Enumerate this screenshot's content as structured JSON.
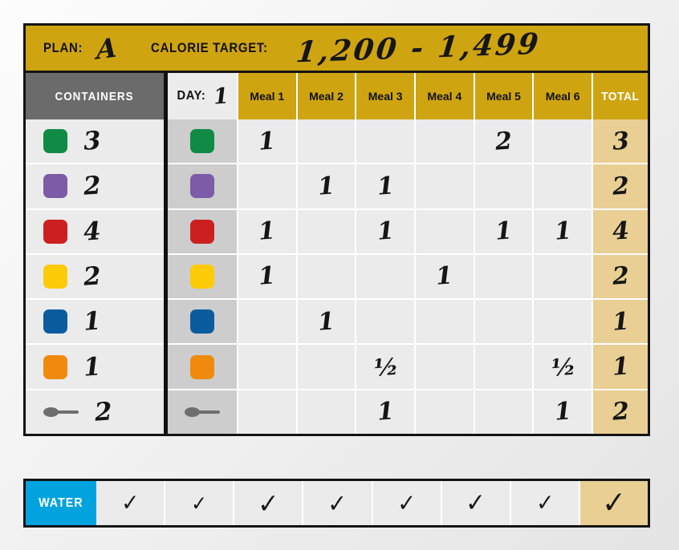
{
  "banner": {
    "plan_label": "PLAN:",
    "plan_value": "A",
    "calorie_label": "CALORIE TARGET:",
    "calorie_value": "1,200 - 1,499",
    "bg_color": "#cfa411"
  },
  "containers_panel": {
    "header": "CONTAINERS",
    "header_bg": "#6b6b6b",
    "rows": [
      {
        "color_name": "green",
        "color": "#0f8b45",
        "icon": "container-swatch",
        "qty": "3"
      },
      {
        "color_name": "purple",
        "color": "#7d5ba6",
        "icon": "container-swatch",
        "qty": "2"
      },
      {
        "color_name": "red",
        "color": "#cc2020",
        "icon": "container-swatch",
        "qty": "4"
      },
      {
        "color_name": "yellow",
        "color": "#fdcb07",
        "icon": "container-swatch",
        "qty": "2"
      },
      {
        "color_name": "blue",
        "color": "#0b5c9e",
        "icon": "container-swatch",
        "qty": "1"
      },
      {
        "color_name": "orange",
        "color": "#f08a0c",
        "icon": "container-swatch",
        "qty": "1"
      },
      {
        "color_name": "spoon",
        "color": "#6e6e6e",
        "icon": "teaspoon-icon",
        "qty": "2"
      }
    ]
  },
  "grid": {
    "day_label": "DAY:",
    "day_value": "1",
    "meal_headers": [
      "Meal 1",
      "Meal 2",
      "Meal 3",
      "Meal 4",
      "Meal 5",
      "Meal 6"
    ],
    "total_header": "TOTAL",
    "total_cell_bg": "#e9cf93",
    "rows": [
      {
        "color_name": "green",
        "color": "#0f8b45",
        "icon": "container-swatch",
        "meals": [
          "1",
          "",
          "",
          "",
          "2",
          ""
        ],
        "total": "3"
      },
      {
        "color_name": "purple",
        "color": "#7d5ba6",
        "icon": "container-swatch",
        "meals": [
          "",
          "1",
          "1",
          "",
          "",
          ""
        ],
        "total": "2"
      },
      {
        "color_name": "red",
        "color": "#cc2020",
        "icon": "container-swatch",
        "meals": [
          "1",
          "",
          "1",
          "",
          "1",
          "1"
        ],
        "total": "4"
      },
      {
        "color_name": "yellow",
        "color": "#fdcb07",
        "icon": "container-swatch",
        "meals": [
          "1",
          "",
          "",
          "1",
          "",
          ""
        ],
        "total": "2"
      },
      {
        "color_name": "blue",
        "color": "#0b5c9e",
        "icon": "container-swatch",
        "meals": [
          "",
          "1",
          "",
          "",
          "",
          ""
        ],
        "total": "1"
      },
      {
        "color_name": "orange",
        "color": "#f08a0c",
        "icon": "container-swatch",
        "meals": [
          "",
          "",
          "½",
          "",
          "",
          "½"
        ],
        "total": "1"
      },
      {
        "color_name": "spoon",
        "color": "#6e6e6e",
        "icon": "teaspoon-icon",
        "meals": [
          "",
          "",
          "1",
          "",
          "",
          "1"
        ],
        "total": "2"
      }
    ]
  },
  "water": {
    "label": "WATER",
    "label_bg": "#00a3dd",
    "checks": [
      "✓",
      "✓",
      "✓",
      "✓",
      "✓",
      "✓",
      "✓",
      "✓"
    ],
    "last_cell_bg": "#e9cf93"
  }
}
